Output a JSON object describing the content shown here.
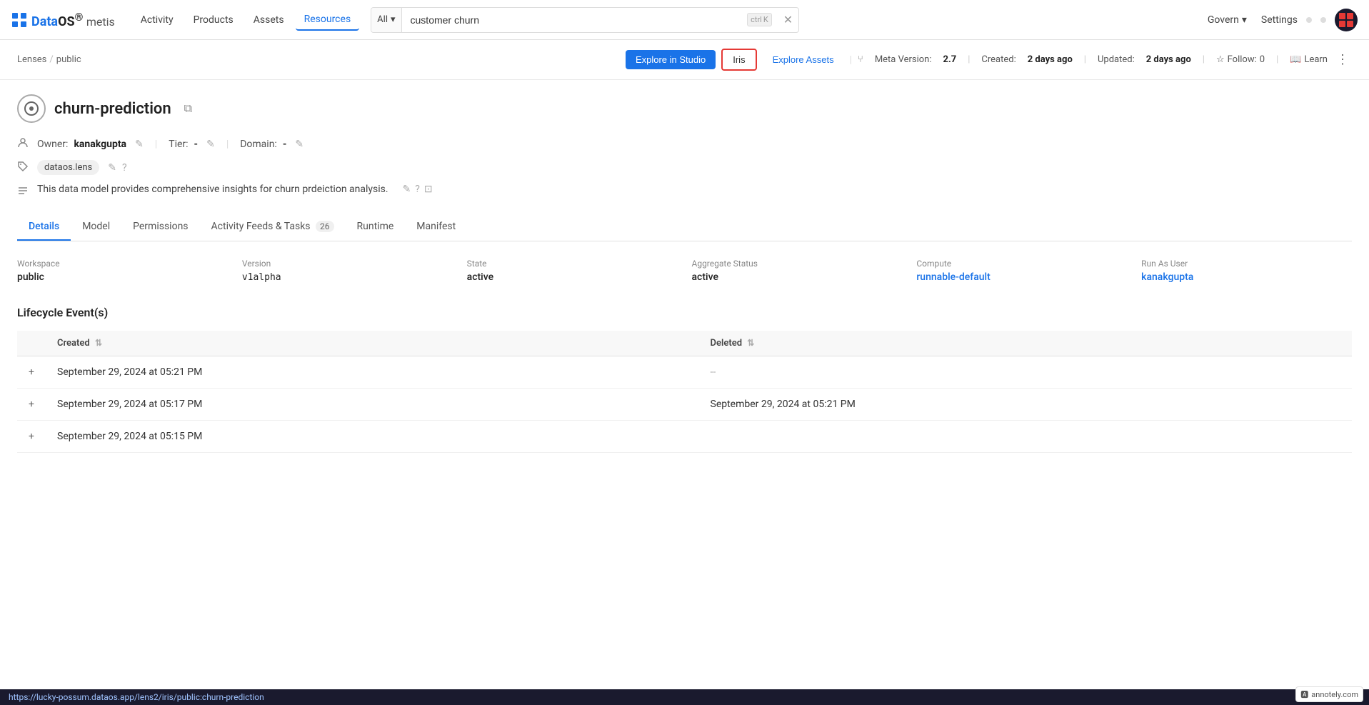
{
  "app": {
    "name": "DataOS",
    "trademark": "®",
    "sub": "metis"
  },
  "nav": {
    "links": [
      "Activity",
      "Products",
      "Assets",
      "Resources"
    ],
    "active": "Resources",
    "search": {
      "scope": "All",
      "value": "customer churn",
      "kbd1": "ctrl",
      "kbd2": "K"
    },
    "govern": "Govern",
    "settings": "Settings"
  },
  "breadcrumb": {
    "items": [
      "Lenses",
      "public"
    ]
  },
  "header_buttons": {
    "explore_studio": "Explore in Studio",
    "iris": "Iris",
    "explore_assets": "Explore Assets"
  },
  "meta": {
    "meta_version_label": "Meta Version:",
    "meta_version": "2.7",
    "created_label": "Created:",
    "created": "2 days ago",
    "updated_label": "Updated:",
    "updated": "2 days ago",
    "follow_label": "Follow:",
    "follow_count": "0",
    "learn": "Learn"
  },
  "resource": {
    "title": "churn-prediction",
    "owner_label": "Owner:",
    "owner": "kanakgupta",
    "tier_label": "Tier:",
    "tier": "-",
    "domain_label": "Domain:",
    "domain": "-",
    "tag": "dataos.lens",
    "description": "This data model provides comprehensive insights for churn prdeiction analysis."
  },
  "tabs": {
    "items": [
      "Details",
      "Model",
      "Permissions",
      "Activity Feeds & Tasks",
      "Runtime",
      "Manifest"
    ],
    "active": "Details",
    "activity_badge": "26"
  },
  "details": {
    "workspace": {
      "label": "Workspace",
      "value": "public"
    },
    "version": {
      "label": "Version",
      "value": "v1alpha"
    },
    "state": {
      "label": "State",
      "value": "active"
    },
    "aggregate_status": {
      "label": "Aggregate Status",
      "value": "active"
    },
    "compute": {
      "label": "Compute",
      "value": "runnable-default"
    },
    "run_as_user": {
      "label": "Run As User",
      "value": "kanakgupta"
    }
  },
  "lifecycle": {
    "title": "Lifecycle Event(s)",
    "columns": {
      "created": "Created",
      "deleted": "Deleted"
    },
    "rows": [
      {
        "created": "September 29, 2024 at 05:21 PM",
        "deleted": "--"
      },
      {
        "created": "September 29, 2024 at 05:17 PM",
        "deleted": "September 29, 2024 at 05:21 PM"
      },
      {
        "created": "September 29, 2024 at 05:15 PM",
        "deleted": ""
      }
    ]
  },
  "status_bar": {
    "url": "https://lucky-possum.dataos.app/lens2/iris/public:churn-prediction"
  },
  "annotely": "annotely.com"
}
